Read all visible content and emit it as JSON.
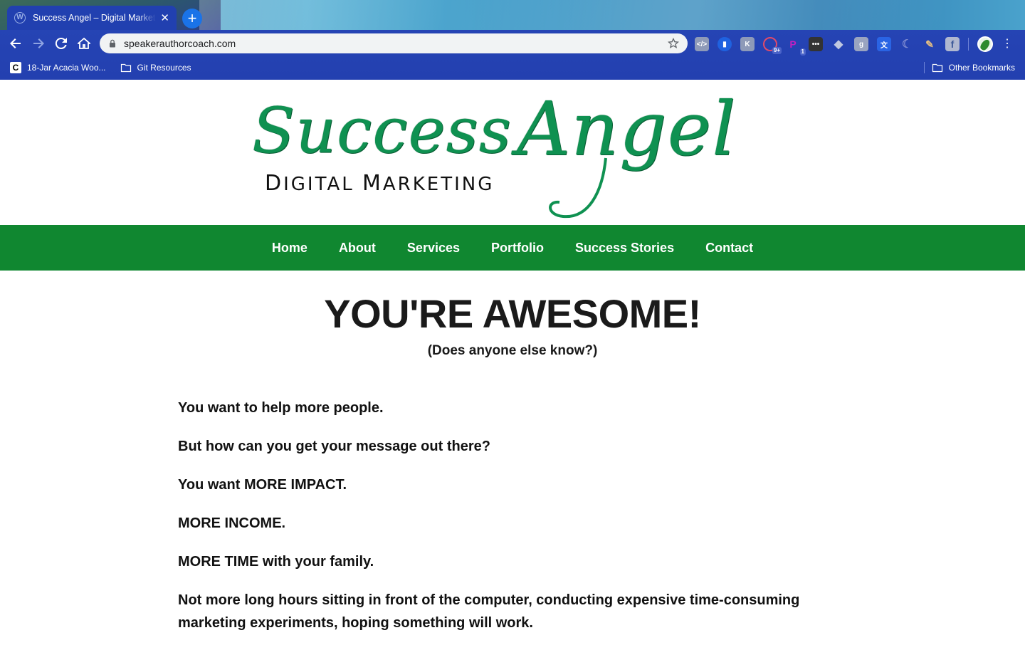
{
  "browser": {
    "tab": {
      "title": "Success Angel – Digital Marketing",
      "favicon": "wordpress-icon"
    },
    "new_tab_label": "+",
    "url": "speakerauthorcoach.com",
    "bookmarks": [
      {
        "label": "18-Jar Acacia Woo...",
        "icon": "c-site-icon"
      },
      {
        "label": "Git Resources",
        "icon": "folder-icon"
      }
    ],
    "other_bookmarks": "Other Bookmarks",
    "extensions": [
      {
        "icon": "code-view-icon"
      },
      {
        "icon": "bookmark-blue-icon"
      },
      {
        "icon": "keyboard-icon"
      },
      {
        "icon": "lastpass-icon",
        "badge": "9+"
      },
      {
        "icon": "p-extension-icon",
        "badge": "1"
      },
      {
        "icon": "more-dots-extension-icon"
      },
      {
        "icon": "puzzle-icon"
      },
      {
        "icon": "google-icon"
      },
      {
        "icon": "translate-icon"
      },
      {
        "icon": "dark-reader-icon"
      },
      {
        "icon": "eyedropper-icon"
      },
      {
        "icon": "facebook-icon"
      }
    ]
  },
  "site": {
    "logo": {
      "script_1": "Success",
      "script_2": "Angel",
      "subtitle_cap1": "D",
      "subtitle_rest1": "IGITAL ",
      "subtitle_cap2": "M",
      "subtitle_rest2": "ARKETING"
    },
    "nav": [
      "Home",
      "About",
      "Services",
      "Portfolio",
      "Success Stories",
      "Contact"
    ],
    "hero": {
      "title": "YOU'RE AWESOME!",
      "subtitle": "(Does anyone else know?)"
    },
    "paragraphs": [
      "You want to help more people.",
      "But how can you get your message out there?",
      "You want MORE IMPACT.",
      "MORE INCOME.",
      "MORE TIME with your family.",
      "Not more long hours sitting in front of  the computer, conducting expensive time-consuming marketing experiments, hoping something will work."
    ],
    "colors": {
      "nav_bg": "#108730",
      "logo_green": "#0f9151",
      "text": "#111111"
    }
  }
}
